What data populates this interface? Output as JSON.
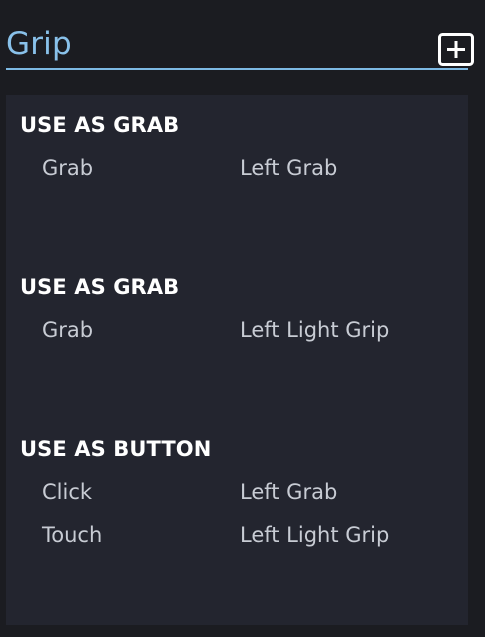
{
  "header": {
    "title": "Grip",
    "add_icon": "add-square-icon",
    "accent_color": "#89c1ea"
  },
  "sections": [
    {
      "title": "USE AS GRAB",
      "rows": [
        {
          "label": "Grab",
          "value": "Left Grab"
        }
      ]
    },
    {
      "title": "USE AS GRAB",
      "rows": [
        {
          "label": "Grab",
          "value": "Left Light Grip"
        }
      ]
    },
    {
      "title": "USE AS BUTTON",
      "rows": [
        {
          "label": "Click",
          "value": "Left Grab"
        },
        {
          "label": "Touch",
          "value": "Left Light Grip"
        }
      ]
    }
  ]
}
